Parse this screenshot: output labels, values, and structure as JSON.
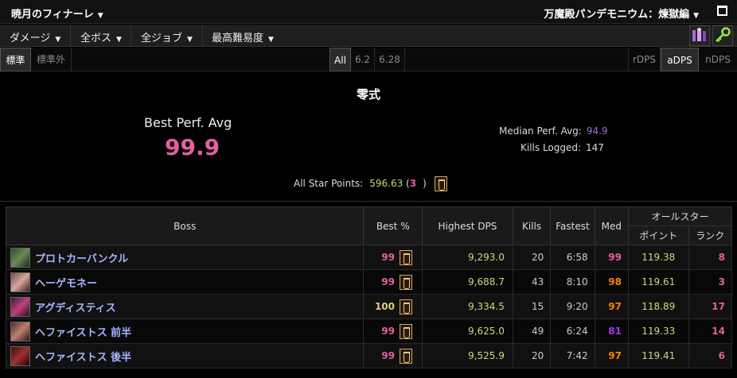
{
  "topbar": {
    "zone": "暁月のフィナーレ",
    "raid": "万魔殿パンデモニウム：煉獄編"
  },
  "filters": [
    {
      "label": "ダメージ"
    },
    {
      "label": "全ボス"
    },
    {
      "label": "全ジョブ"
    },
    {
      "label": "最高難易度"
    }
  ],
  "tabs": {
    "standard": "標準",
    "nonstandard": "標準外",
    "all": "All",
    "v62": "6.2",
    "v628": "6.28",
    "rdps": "rDPS",
    "adps": "aDPS",
    "ndps": "nDPS"
  },
  "summary": {
    "title": "零式",
    "best_label": "Best Perf. Avg",
    "best_value": "99.9",
    "median_label": "Median Perf. Avg:",
    "median_value": "94.9",
    "kills_label": "Kills Logged:",
    "kills_value": "147",
    "asp_label": "All Star Points:",
    "asp_value": "596.63",
    "asp_rank_open": "(",
    "asp_rank": "3",
    "asp_rank_close": ")"
  },
  "table": {
    "headers": {
      "boss": "Boss",
      "best": "Best %",
      "highest_dps": "Highest DPS",
      "kills": "Kills",
      "fastest": "Fastest",
      "med": "Med",
      "allstar": "オールスター",
      "points": "ポイント",
      "rank": "ランク"
    },
    "rows": [
      {
        "name": "プロトカーバンクル",
        "best": "99",
        "dps": "9,293.0",
        "kills": "20",
        "fastest": "6:58",
        "med": "99",
        "points": "119.38",
        "rank": "8"
      },
      {
        "name": "ヘーゲモネー",
        "best": "99",
        "dps": "9,688.7",
        "kills": "43",
        "fastest": "8:10",
        "med": "98",
        "points": "119.61",
        "rank": "3"
      },
      {
        "name": "アグディスティス",
        "best": "100",
        "dps": "9,334.5",
        "kills": "15",
        "fastest": "9:20",
        "med": "97",
        "points": "118.89",
        "rank": "17"
      },
      {
        "name": "ヘファイストス 前半",
        "best": "99",
        "dps": "9,625.0",
        "kills": "49",
        "fastest": "6:24",
        "med": "81",
        "points": "119.33",
        "rank": "14"
      },
      {
        "name": "ヘファイストス 後半",
        "best": "99",
        "dps": "9,525.9",
        "kills": "20",
        "fastest": "7:42",
        "med": "97",
        "points": "119.41",
        "rank": "6"
      }
    ]
  },
  "colors": {
    "best_pink": "#e45ea2",
    "best_gold": "#e5cc80",
    "med_orange": "#ff8000",
    "med_purple": "#a335ee",
    "dps_green": "#c7dd7a",
    "boss_blue": "#a8b5ff"
  },
  "icons": [
    "caret-down-icon",
    "window-icon",
    "party-icon",
    "key-icon",
    "parse-badge-icon"
  ]
}
